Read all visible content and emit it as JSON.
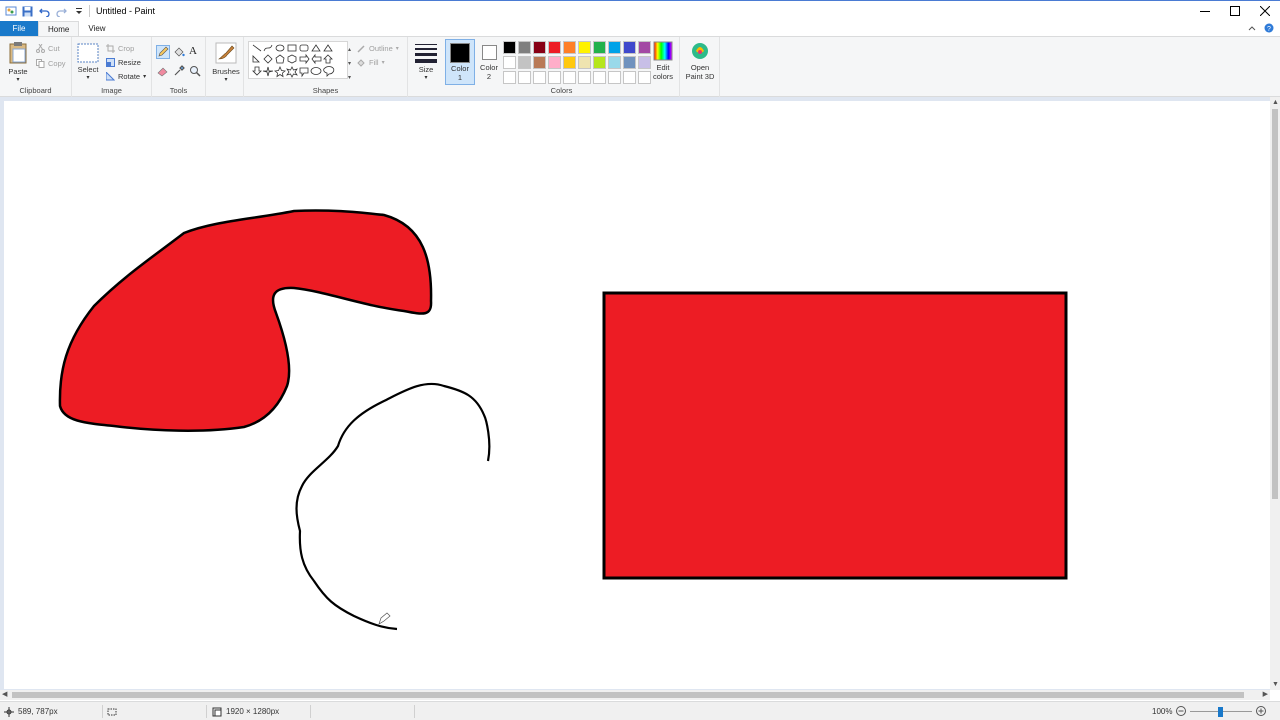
{
  "window": {
    "title": "Untitled - Paint"
  },
  "tabs": [
    {
      "label": "File"
    },
    {
      "label": "Home"
    },
    {
      "label": "View"
    }
  ],
  "ribbon": {
    "clipboard": {
      "paste": "Paste",
      "cut": "Cut",
      "copy": "Copy",
      "group": "Clipboard"
    },
    "image": {
      "select": "Select",
      "crop": "Crop",
      "resize": "Resize",
      "rotate": "Rotate",
      "group": "Image"
    },
    "tools": {
      "group": "Tools",
      "text": "A"
    },
    "brushes": {
      "label": "Brushes"
    },
    "shapes": {
      "outline": "Outline",
      "fill": "Fill",
      "group": "Shapes"
    },
    "size": {
      "label": "Size"
    },
    "color1": {
      "label_line1": "Color",
      "label_line2": "1",
      "value": "#000000"
    },
    "color2": {
      "label_line1": "Color",
      "label_line2": "2",
      "value": "#ffffff"
    },
    "colors": {
      "group": "Colors",
      "palette": [
        "#000000",
        "#7f7f7f",
        "#880015",
        "#ed1c24",
        "#ff7f27",
        "#fff200",
        "#22b14c",
        "#00a2e8",
        "#3f48cc",
        "#a349a4",
        "#ffffff",
        "#c3c3c3",
        "#b97a57",
        "#ffaec9",
        "#ffc90e",
        "#efe4b0",
        "#b5e61d",
        "#99d9ea",
        "#7092be",
        "#c8bfe7",
        "#ffffff",
        "#ffffff",
        "#ffffff",
        "#ffffff",
        "#ffffff",
        "#ffffff",
        "#ffffff",
        "#ffffff",
        "#ffffff",
        "#ffffff"
      ]
    },
    "edit_colors": {
      "line1": "Edit",
      "line2": "colors"
    },
    "paint3d": {
      "line1": "Open",
      "line2": "Paint 3D"
    }
  },
  "canvas": {
    "fill_color": "#ed1c24",
    "stroke_color": "#000000"
  },
  "status": {
    "cursor": "589, 787px",
    "image_size": "1920 × 1280px",
    "zoom": "100%"
  }
}
